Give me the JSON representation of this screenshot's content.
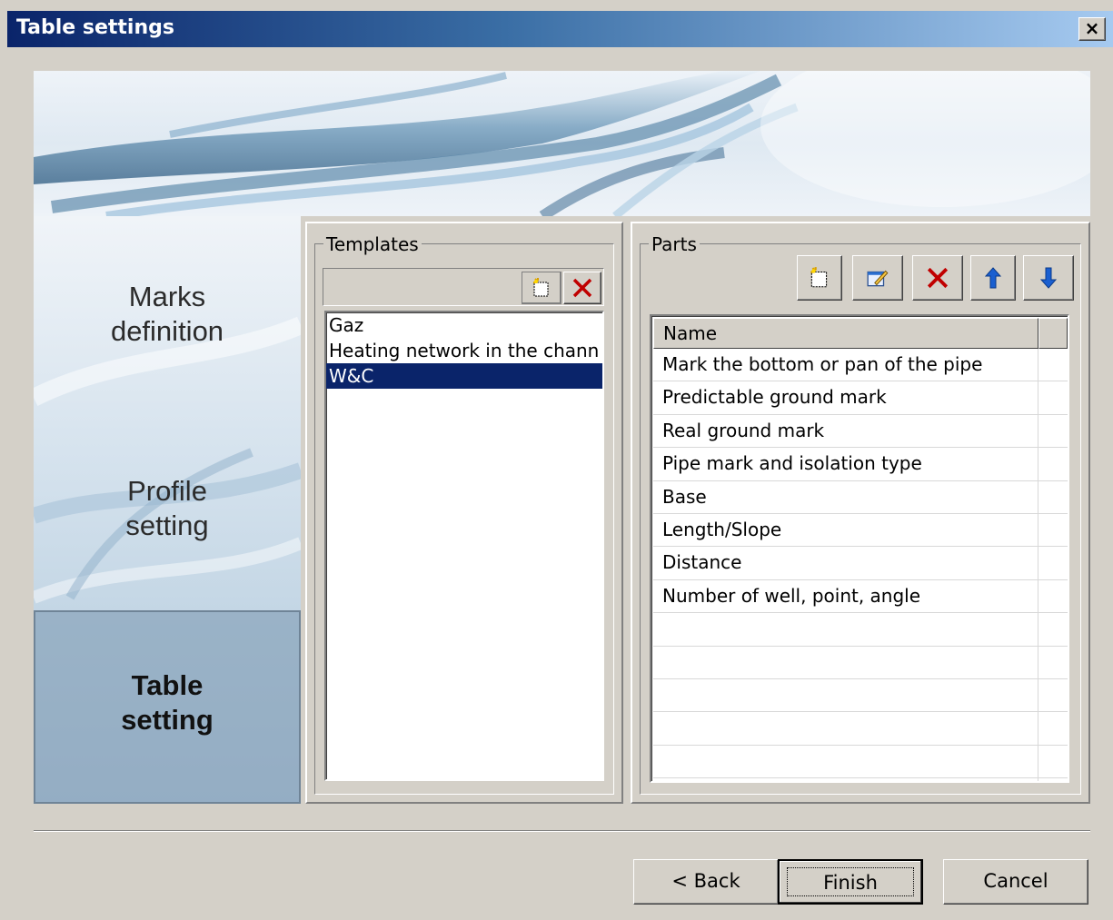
{
  "window": {
    "title": "Table settings",
    "close_label": "×"
  },
  "nav": {
    "items": [
      {
        "label": "Marks\ndefinition",
        "line1": "Marks",
        "line2": "definition",
        "active": false
      },
      {
        "label": "Profile\nsetting",
        "line1": "Profile",
        "line2": "setting",
        "active": false
      },
      {
        "label": "Table\nsetting",
        "line1": "Table",
        "line2": "setting",
        "active": true
      }
    ]
  },
  "templates": {
    "legend": "Templates",
    "items": [
      "Gaz",
      "Heating network in the chann",
      "W&C"
    ],
    "selected_index": 2,
    "toolbar": {
      "new_icon": "new-document-icon",
      "delete_icon": "delete-icon"
    }
  },
  "parts": {
    "legend": "Parts",
    "toolbar": [
      "new-document-icon",
      "edit-icon",
      "delete-icon",
      "arrow-up-icon",
      "arrow-down-icon"
    ],
    "columns": [
      "Name",
      ""
    ],
    "rows": [
      "Mark the bottom or pan of the pipe",
      "Predictable ground mark",
      "Real ground mark",
      "Pipe mark and isolation type",
      "Base",
      "Length/Slope",
      "Distance",
      "Number of well, point, angle",
      "",
      "",
      "",
      "",
      "",
      ""
    ]
  },
  "buttons": {
    "back": "< Back",
    "finish": "Finish",
    "cancel": "Cancel"
  },
  "colors": {
    "titlebar_start": "#0a246a",
    "titlebar_end": "#a6caf0",
    "selection": "#0a246a",
    "delete_red": "#c00000",
    "arrow_blue": "#1a5fd0"
  }
}
